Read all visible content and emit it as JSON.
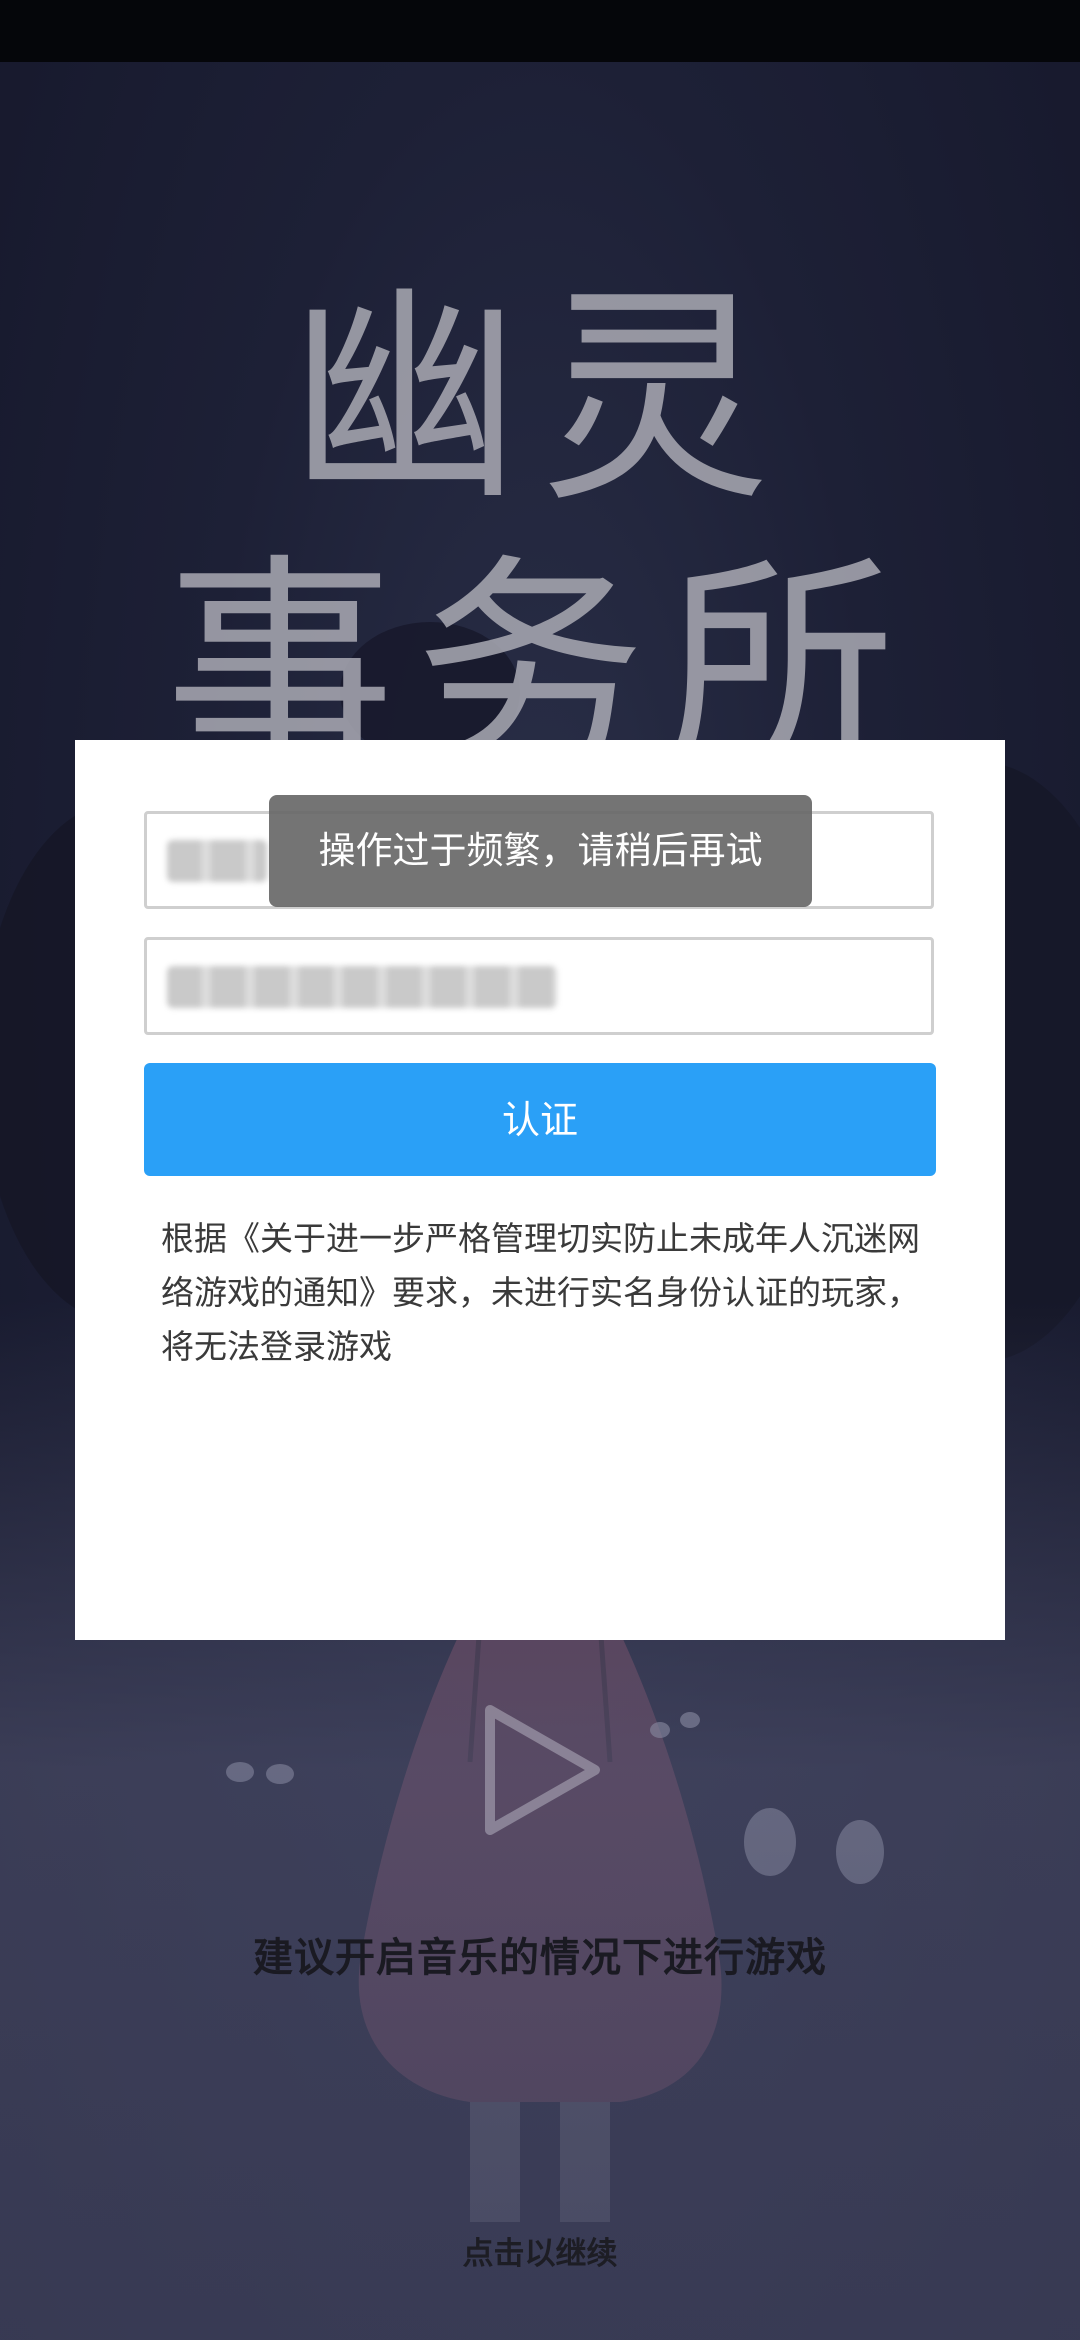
{
  "app": {
    "title_line1": "幽灵",
    "title_line2": "事务所"
  },
  "dialog": {
    "name_input_value": "",
    "id_input_value": "",
    "submit_label": "认证",
    "notice": "根据《关于进一步严格管理切实防止未成年人沉迷网络游戏的通知》要求，未进行实名身份认证的玩家，将无法登录游戏"
  },
  "toast": {
    "message": "操作过于频繁，请稍后再试"
  },
  "background": {
    "hint": "建议开启音乐的情况下进行游戏",
    "continue": "点击以继续"
  },
  "colors": {
    "accent": "#2aa0f7",
    "toast_bg": "#686868",
    "background": "#1d2036"
  },
  "icons": {
    "play": "play-icon"
  }
}
